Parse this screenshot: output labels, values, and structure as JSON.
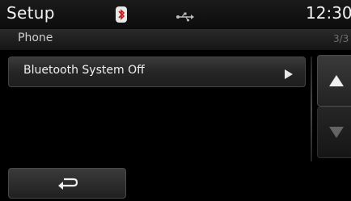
{
  "header": {
    "title": "Setup",
    "clock": "12:30",
    "icons": [
      "bluetooth-icon",
      "usb-icon"
    ]
  },
  "subheader": {
    "section": "Phone",
    "page": "3/3"
  },
  "list": {
    "items": [
      {
        "label": "Bluetooth System Off",
        "icon": "play-arrow-icon"
      }
    ]
  },
  "scroll": {
    "up_icon": "triangle-up-icon",
    "down_icon": "triangle-down-icon"
  },
  "footer": {
    "back_icon": "return-arrow-icon"
  }
}
